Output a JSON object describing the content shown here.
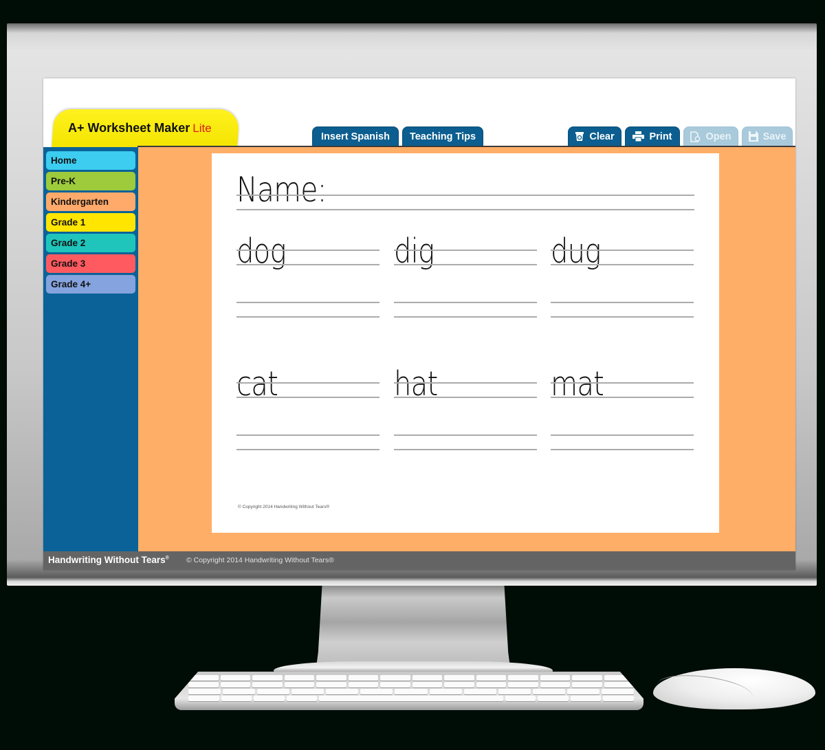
{
  "app": {
    "title": "A+ Worksheet Maker",
    "edition": "Lite"
  },
  "toolbar": {
    "tabs": [
      {
        "label": "Insert Spanish"
      },
      {
        "label": "Teaching Tips"
      }
    ],
    "actions": [
      {
        "label": "Clear",
        "icon": "recycle-bin-icon",
        "enabled": true
      },
      {
        "label": "Print",
        "icon": "printer-icon",
        "enabled": true
      },
      {
        "label": "Open",
        "icon": "open-document-icon",
        "enabled": false
      },
      {
        "label": "Save",
        "icon": "floppy-disk-icon",
        "enabled": false
      }
    ]
  },
  "sidebar": {
    "items": [
      {
        "label": "Home",
        "color": "#3ccdf0"
      },
      {
        "label": "Pre-K",
        "color": "#9dcb3b"
      },
      {
        "label": "Kindergarten",
        "color": "#ffaa6a"
      },
      {
        "label": "Grade 1",
        "color": "#ffe500"
      },
      {
        "label": "Grade 2",
        "color": "#1fc5bb"
      },
      {
        "label": "Grade 3",
        "color": "#ff5a5f"
      },
      {
        "label": "Grade 4+",
        "color": "#85a3de"
      }
    ]
  },
  "worksheet": {
    "name_label": "Name:",
    "words": [
      "dog",
      "dig",
      "dug",
      "cat",
      "hat",
      "mat"
    ],
    "copyright": "© Copyright 2014 Handwriting Without Tears®"
  },
  "footer": {
    "brand": "Handwriting Without Tears",
    "brand_mark": "®",
    "copyright": "© Copyright 2014 Handwriting Without Tears®"
  },
  "colors": {
    "accent_blue": "#0b5e8f",
    "workspace_orange": "#ffae67",
    "title_tab_yellow": "#fff21e",
    "footer_gray": "#646464"
  }
}
